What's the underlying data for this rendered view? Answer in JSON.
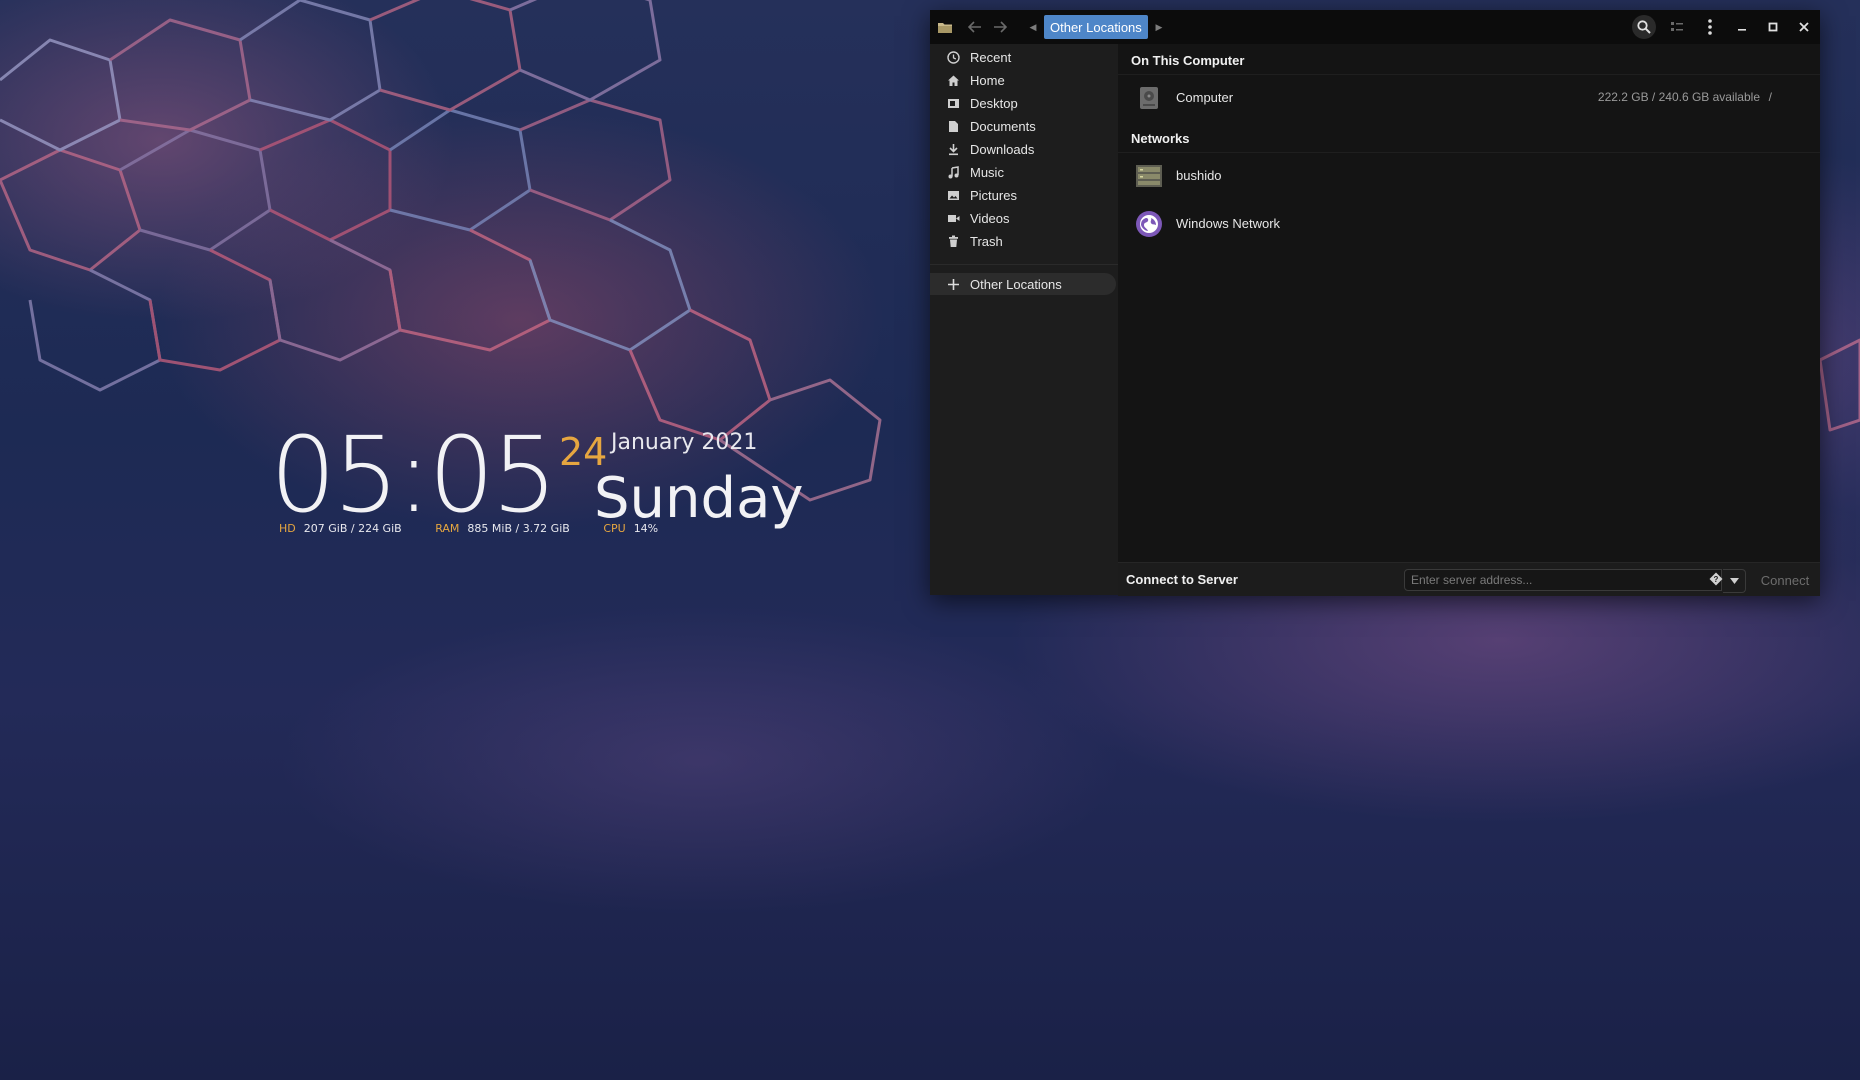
{
  "desktop": {
    "clock": {
      "time": "05:05",
      "day_number": "24",
      "month_year": "January 2021",
      "weekday": "Sunday"
    },
    "stats": [
      {
        "label": "HD",
        "value": "207 GiB / 224 GiB"
      },
      {
        "label": "RAM",
        "value": "885 MiB / 3.72 GiB"
      },
      {
        "label": "CPU",
        "value": "14%"
      }
    ],
    "accent_color": "#e6a640"
  },
  "window": {
    "path_current": "Other Locations",
    "accent_color": "#4e86c8",
    "toolbar_icons": [
      "home-folder-icon",
      "back-arrow-icon",
      "forward-arrow-icon",
      "search-icon",
      "view-options-icon",
      "menu-icon",
      "minimize-icon",
      "maximize-icon",
      "close-icon"
    ],
    "sidebar": {
      "items": [
        {
          "label": "Recent",
          "icon": "clock-icon"
        },
        {
          "label": "Home",
          "icon": "home-icon"
        },
        {
          "label": "Desktop",
          "icon": "desktop-icon"
        },
        {
          "label": "Documents",
          "icon": "document-icon"
        },
        {
          "label": "Downloads",
          "icon": "download-icon"
        },
        {
          "label": "Music",
          "icon": "music-icon"
        },
        {
          "label": "Pictures",
          "icon": "picture-icon"
        },
        {
          "label": "Videos",
          "icon": "video-icon"
        },
        {
          "label": "Trash",
          "icon": "trash-icon"
        }
      ],
      "other_locations": {
        "label": "Other Locations",
        "icon": "plus-icon"
      }
    },
    "on_this_computer": {
      "heading": "On This Computer",
      "items": [
        {
          "name": "Computer",
          "info": "222.2 GB / 240.6 GB available",
          "mount": "/",
          "icon": "drive-icon"
        }
      ]
    },
    "networks": {
      "heading": "Networks",
      "items": [
        {
          "name": "bushido",
          "icon": "server-icon"
        },
        {
          "name": "Windows Network",
          "icon": "network-globe-icon"
        }
      ]
    },
    "connect": {
      "label": "Connect to Server",
      "placeholder": "Enter server address...",
      "button": "Connect"
    }
  }
}
